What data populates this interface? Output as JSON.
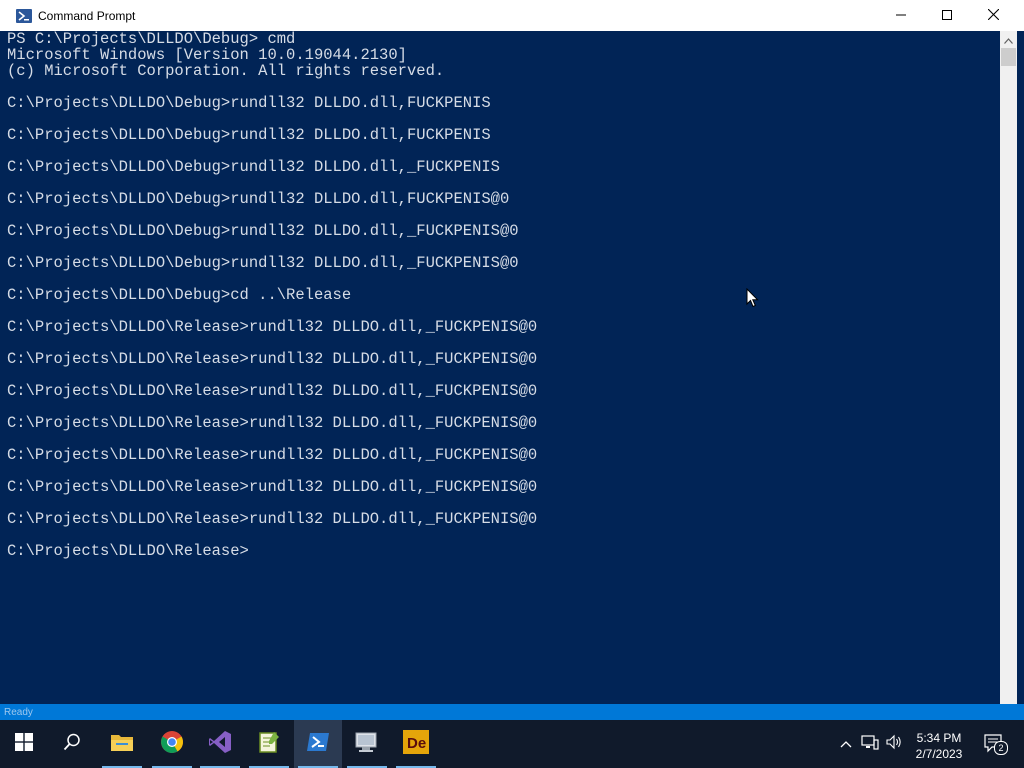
{
  "window": {
    "title": "Command Prompt",
    "icon": "powershell-icon"
  },
  "controls": {
    "minimize": "minimize-icon",
    "maximize": "maximize-icon",
    "close": "close-icon"
  },
  "console": {
    "lines": [
      "PS C:\\Projects\\DLLDO\\Debug> cmd",
      "Microsoft Windows [Version 10.0.19044.2130]",
      "(c) Microsoft Corporation. All rights reserved.",
      "",
      "C:\\Projects\\DLLDO\\Debug>rundll32 DLLDO.dll,FUCKPENIS",
      "",
      "C:\\Projects\\DLLDO\\Debug>rundll32 DLLDO.dll,FUCKPENIS",
      "",
      "C:\\Projects\\DLLDO\\Debug>rundll32 DLLDO.dll,_FUCKPENIS",
      "",
      "C:\\Projects\\DLLDO\\Debug>rundll32 DLLDO.dll,FUCKPENIS@0",
      "",
      "C:\\Projects\\DLLDO\\Debug>rundll32 DLLDO.dll,_FUCKPENIS@0",
      "",
      "C:\\Projects\\DLLDO\\Debug>rundll32 DLLDO.dll,_FUCKPENIS@0",
      "",
      "C:\\Projects\\DLLDO\\Debug>cd ..\\Release",
      "",
      "C:\\Projects\\DLLDO\\Release>rundll32 DLLDO.dll,_FUCKPENIS@0",
      "",
      "C:\\Projects\\DLLDO\\Release>rundll32 DLLDO.dll,_FUCKPENIS@0",
      "",
      "C:\\Projects\\DLLDO\\Release>rundll32 DLLDO.dll,_FUCKPENIS@0",
      "",
      "C:\\Projects\\DLLDO\\Release>rundll32 DLLDO.dll,_FUCKPENIS@0",
      "",
      "C:\\Projects\\DLLDO\\Release>rundll32 DLLDO.dll,_FUCKPENIS@0",
      "",
      "C:\\Projects\\DLLDO\\Release>rundll32 DLLDO.dll,_FUCKPENIS@0",
      "",
      "C:\\Projects\\DLLDO\\Release>rundll32 DLLDO.dll,_FUCKPENIS@0",
      "",
      "C:\\Projects\\DLLDO\\Release>"
    ],
    "background": "#012456",
    "foreground": "#d6dce6"
  },
  "statusband": {
    "text": "Ready"
  },
  "taskbar": {
    "apps": [
      {
        "name": "start-icon"
      },
      {
        "name": "search-icon"
      },
      {
        "name": "file-explorer-icon"
      },
      {
        "name": "chrome-icon"
      },
      {
        "name": "visual-studio-icon"
      },
      {
        "name": "notepad-plus-plus-icon"
      },
      {
        "name": "powershell-icon",
        "active": true
      },
      {
        "name": "network-monitor-icon"
      },
      {
        "name": "delphi-icon"
      }
    ],
    "clock": {
      "time": "5:34 PM",
      "date": "2/7/2023"
    },
    "notifications_count": "2"
  },
  "colors": {
    "taskbar": "#101a2b",
    "accent": "#0078d7"
  }
}
